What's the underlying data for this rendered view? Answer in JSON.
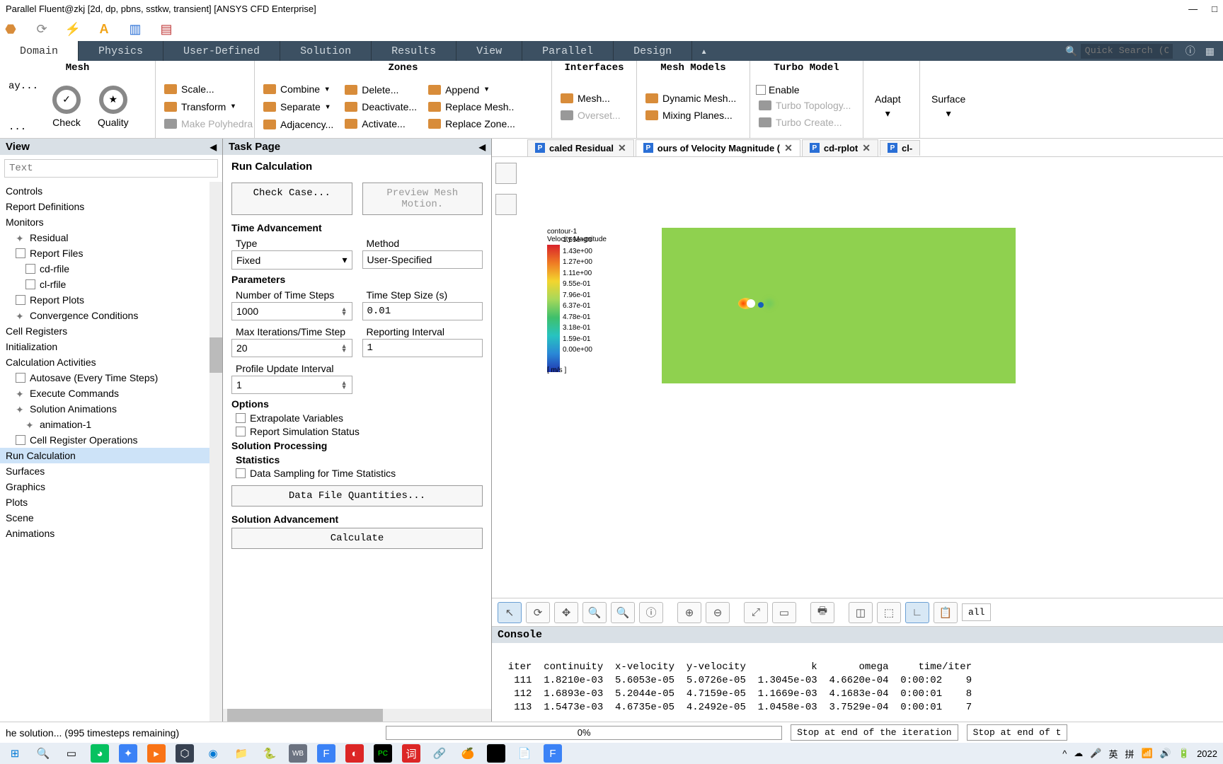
{
  "titlebar": "Parallel Fluent@zkj  [2d, dp, pbns, sstkw, transient] [ANSYS CFD Enterprise]",
  "window_controls": {
    "min": "—",
    "max": "□"
  },
  "tabs": {
    "domain": "Domain",
    "physics": "Physics",
    "userdef": "User-Defined",
    "solution": "Solution",
    "results": "Results",
    "view": "View",
    "parallel": "Parallel",
    "design": "Design"
  },
  "quicksearch_placeholder": "Quick Search (Ct…",
  "ribbon": {
    "mesh": "Mesh",
    "check": "Check",
    "quality": "Quality",
    "info_label": "ay...",
    "units_label": "...",
    "scale": "Scale...",
    "transform": "Transform",
    "polyhedra": "Make Polyhedra",
    "zones": "Zones",
    "combine": "Combine",
    "separate": "Separate",
    "adjacency": "Adjacency...",
    "delete": "Delete...",
    "deactivate": "Deactivate...",
    "activate": "Activate...",
    "append": "Append",
    "replace_mesh": "Replace Mesh..",
    "replace_zone": "Replace Zone...",
    "interfaces": "Interfaces",
    "mesh_btn": "Mesh...",
    "overset": "Overset...",
    "mesh_models": "Mesh Models",
    "dynamic": "Dynamic Mesh...",
    "mixing": "Mixing Planes...",
    "turbo": "Turbo Model",
    "enable": "Enable",
    "topo": "Turbo Topology...",
    "create": "Turbo Create...",
    "adapt": "Adapt",
    "surface": "Surface"
  },
  "outline": {
    "title": "View",
    "search_placeholder": "Text",
    "items": [
      {
        "label": "Controls",
        "indent": 0
      },
      {
        "label": "Report Definitions",
        "indent": 0
      },
      {
        "label": "Monitors",
        "indent": 0
      },
      {
        "label": "Residual",
        "indent": 1,
        "icon": "star"
      },
      {
        "label": "Report Files",
        "indent": 1,
        "icon": "doc"
      },
      {
        "label": "cd-rfile",
        "indent": 2,
        "icon": "doc"
      },
      {
        "label": "cl-rfile",
        "indent": 2,
        "icon": "doc"
      },
      {
        "label": "Report Plots",
        "indent": 1,
        "icon": "doc"
      },
      {
        "label": "Convergence Conditions",
        "indent": 1,
        "icon": "star"
      },
      {
        "label": "Cell Registers",
        "indent": 0
      },
      {
        "label": "Initialization",
        "indent": 0
      },
      {
        "label": "Calculation Activities",
        "indent": 0
      },
      {
        "label": "Autosave (Every Time Steps)",
        "indent": 1,
        "icon": "doc"
      },
      {
        "label": "Execute Commands",
        "indent": 1,
        "icon": "star"
      },
      {
        "label": "Solution Animations",
        "indent": 1,
        "icon": "star"
      },
      {
        "label": "animation-1",
        "indent": 2,
        "icon": "star"
      },
      {
        "label": "Cell Register Operations",
        "indent": 1,
        "icon": "doc"
      },
      {
        "label": "Run Calculation",
        "indent": 0,
        "selected": true
      },
      {
        "label": "Surfaces",
        "indent": 0
      },
      {
        "label": "Graphics",
        "indent": 0
      },
      {
        "label": "Plots",
        "indent": 0
      },
      {
        "label": "Scene",
        "indent": 0
      },
      {
        "label": "Animations",
        "indent": 0
      }
    ]
  },
  "task": {
    "pane_title": "Task Page",
    "title": "Run Calculation",
    "check_case": "Check Case...",
    "preview": "Preview Mesh Motion.",
    "time_adv": "Time Advancement",
    "type_label": "Type",
    "type_value": "Fixed",
    "method_label": "Method",
    "method_value": "User-Specified",
    "params": "Parameters",
    "nts_label": "Number of Time Steps",
    "nts_value": "1000",
    "tss_label": "Time Step Size (s)",
    "tss_value": "0.01",
    "max_iter_label": "Max Iterations/Time Step",
    "max_iter_value": "20",
    "rep_int_label": "Reporting Interval",
    "rep_int_value": "1",
    "pui_label": "Profile Update Interval",
    "pui_value": "1",
    "options": "Options",
    "extrapolate": "Extrapolate Variables",
    "report_sim": "Report Simulation Status",
    "sol_proc": "Solution Processing",
    "stats": "Statistics",
    "data_sampling": "Data Sampling for Time Statistics",
    "dfq": "Data File Quantities...",
    "sol_adv": "Solution Advancement",
    "calculate": "Calculate"
  },
  "viewer": {
    "tabs": {
      "scaled": "caled Residual",
      "contours": "ours of Velocity Magnitude (",
      "cd": "cd-rplot",
      "cl": "cl-"
    },
    "legend_title1": "contour-1",
    "legend_title2": "Velocity Magnitude",
    "legend_vals": [
      "1.59e+00",
      "1.43e+00",
      "1.27e+00",
      "1.11e+00",
      "9.55e-01",
      "7.96e-01",
      "6.37e-01",
      "4.78e-01",
      "3.18e-01",
      "1.59e-01",
      "0.00e+00"
    ],
    "legend_unit": "[ m/s ]",
    "toolbar_all": "all"
  },
  "console": {
    "title": "Console",
    "header": "  iter  continuity  x-velocity  y-velocity           k       omega     time/iter",
    "rows": [
      "   111  1.8210e-03  5.6053e-05  5.0726e-05  1.3045e-03  4.6620e-04  0:00:02    9",
      "   112  1.6893e-03  5.2044e-05  4.7159e-05  1.1669e-03  4.1683e-04  0:00:01    8",
      "   113  1.5473e-03  4.6735e-05  4.2492e-05  1.0458e-03  3.7529e-04  0:00:01    7"
    ]
  },
  "status": {
    "text": "he solution... (995 timesteps remaining)",
    "progress": "0%",
    "stop1": "Stop at end of the iteration",
    "stop2": "Stop at end of t"
  },
  "taskbar_date": "2022"
}
